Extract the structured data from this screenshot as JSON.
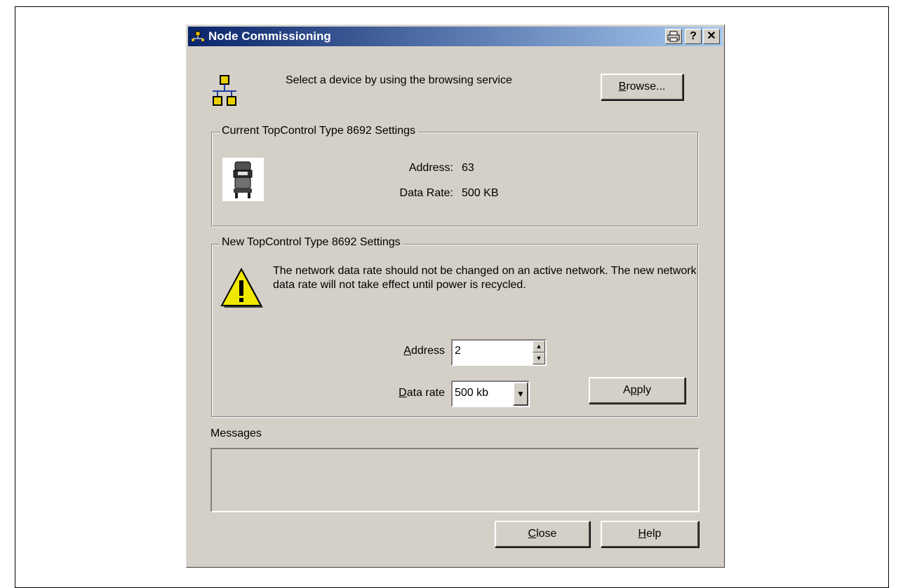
{
  "window": {
    "title": "Node Commissioning",
    "print_icon": "print-icon",
    "help_label": "?",
    "close_label": "✕"
  },
  "browse": {
    "text": "Select a device by using the browsing service",
    "button_pre": "B",
    "button_post": "rowse..."
  },
  "current": {
    "legend": "Current TopControl Type 8692 Settings",
    "address_label": "Address:",
    "address_value": "63",
    "rate_label": "Data Rate:",
    "rate_value": "500 KB"
  },
  "new_settings": {
    "legend": "New TopControl Type 8692 Settings",
    "warning": "The network data rate should not be changed on an active network. The new network data rate will not take effect until power is recycled.",
    "address_label_pre": "A",
    "address_label_post": "ddress",
    "address_value": "2",
    "rate_label_pre": "D",
    "rate_label_post": "ata rate",
    "rate_value": "500 kb",
    "apply_pre": "A",
    "apply_u": "p",
    "apply_post": "ply"
  },
  "messages": {
    "label": "Messages",
    "content": ""
  },
  "footer": {
    "close_pre": "C",
    "close_post": "lose",
    "help_pre": "H",
    "help_post": "elp"
  }
}
